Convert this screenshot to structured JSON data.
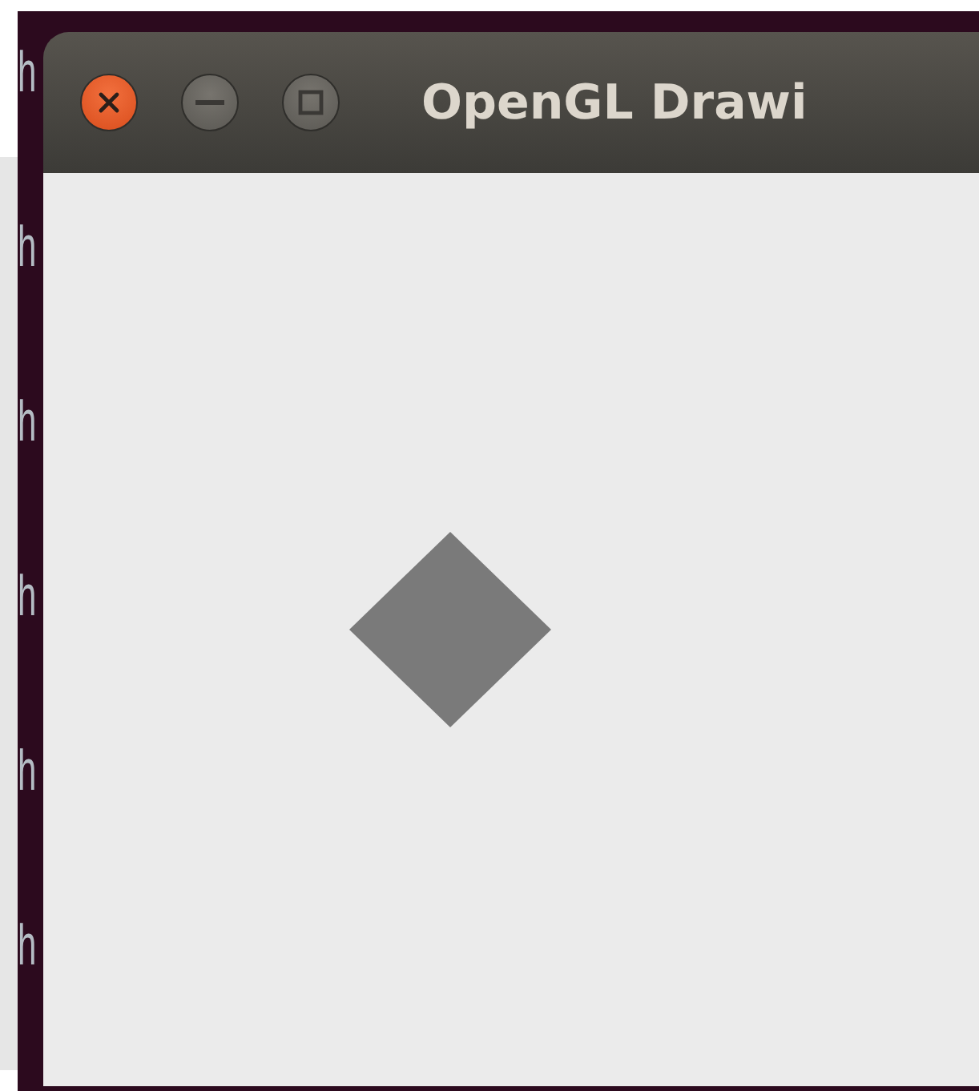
{
  "terminal_lines": [
    "h",
    "h",
    "h",
    "h",
    "h",
    "h"
  ],
  "window": {
    "title": "OpenGL Drawi"
  },
  "canvas": {
    "shapes": [
      {
        "kind": "diamond"
      }
    ]
  }
}
